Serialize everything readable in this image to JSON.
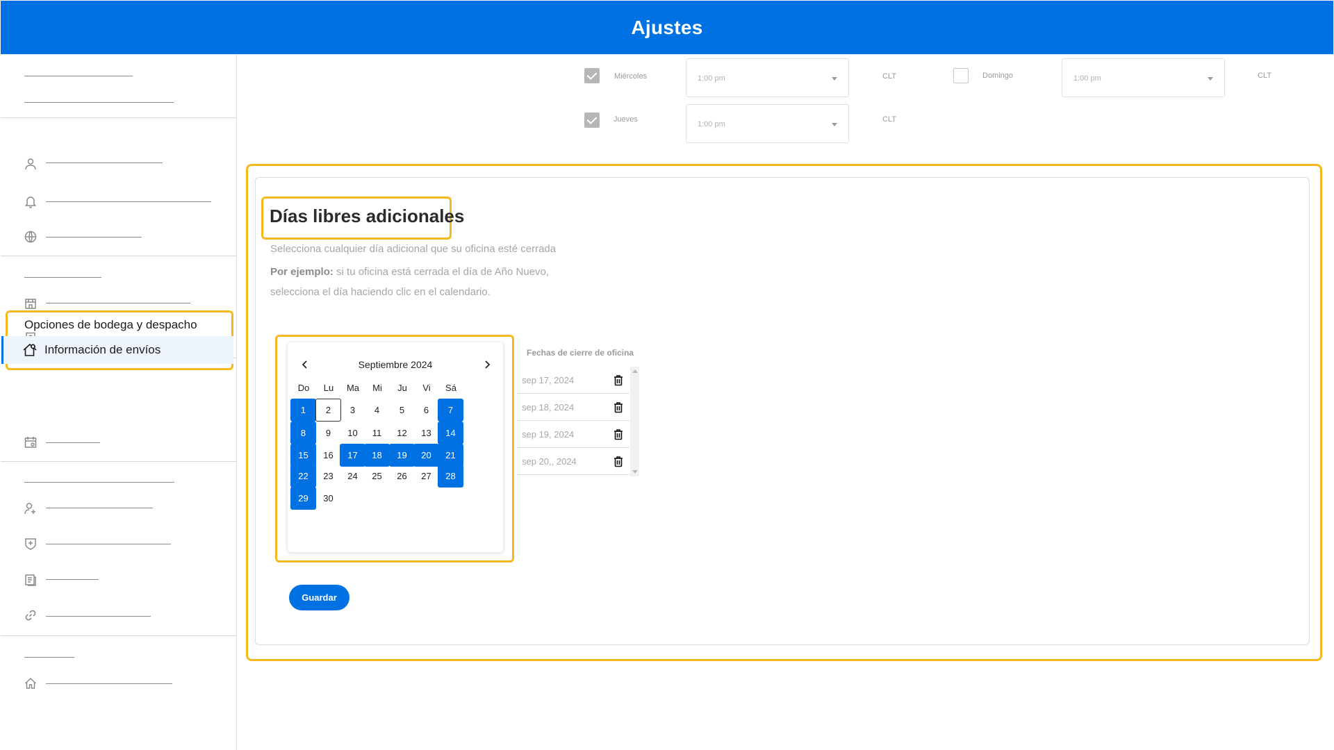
{
  "header": {
    "title": "Ajustes"
  },
  "sidebar": {
    "section_label": "Opciones de bodega y despacho",
    "active_item": "Información de envíos",
    "colors": {
      "active_bg": "#eef4fb",
      "accent": "#0071e3",
      "highlight": "#f6b81b"
    }
  },
  "schedule": {
    "rows": [
      {
        "day": "Miércoles",
        "checked": true,
        "time": "1:00 pm",
        "tz": "CLT"
      },
      {
        "day": "Jueves",
        "checked": true,
        "time": "1:00 pm",
        "tz": "CLT"
      },
      {
        "day": "Domingo",
        "checked": false,
        "time": "1:00 pm",
        "tz": "CLT"
      }
    ]
  },
  "section": {
    "title": "Días libres adicionales",
    "desc1": "Selecciona cualquier día adicional que su oficina esté cerrada",
    "example_label": "Por ejemplo:",
    "example_text": " si tu oficina está cerrada el día de Año Nuevo,",
    "desc3": "selecciona el día haciendo clic en el calendario."
  },
  "calendar": {
    "month": "Septiembre 2024",
    "prev_icon": "chevron-left-icon",
    "next_icon": "chevron-right-icon",
    "weekdays": [
      "Do",
      "Lu",
      "Ma",
      "Mi",
      "Ju",
      "Vi",
      "Sá"
    ],
    "first_weekday_index": 0,
    "days_in_month": 30,
    "selected_days": [
      1,
      7,
      8,
      14,
      15,
      17,
      18,
      19,
      20,
      21,
      22,
      28,
      29
    ],
    "outlined_day": 2
  },
  "closures": {
    "header": "Fechas de cierre de oficina",
    "dates": [
      "sep 17, 2024",
      "sep 18, 2024",
      "sep 19, 2024",
      "sep 20,, 2024"
    ]
  },
  "actions": {
    "save_label": "Guardar"
  }
}
